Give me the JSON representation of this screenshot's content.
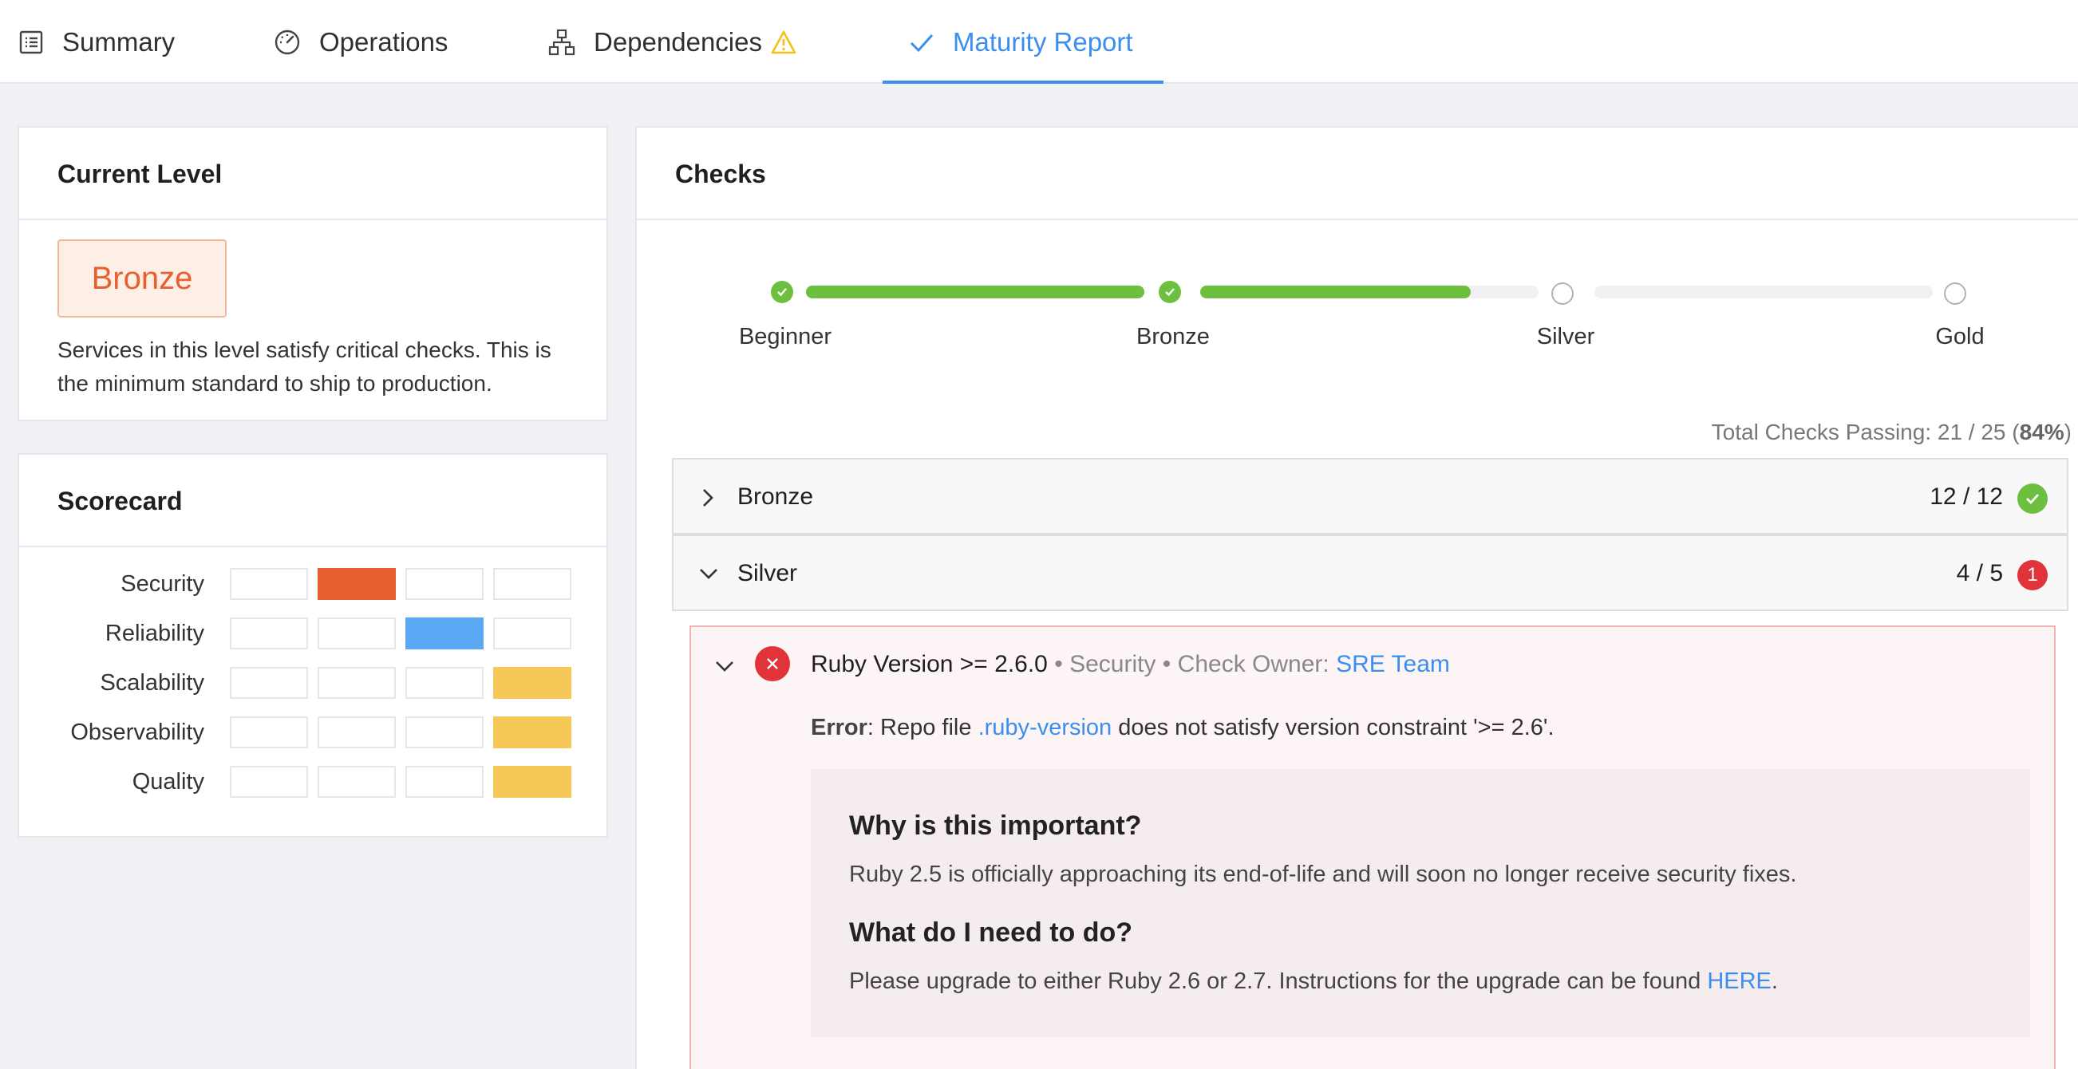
{
  "tabs": [
    {
      "label": "Summary",
      "icon": "list-icon"
    },
    {
      "label": "Operations",
      "icon": "gauge-icon"
    },
    {
      "label": "Dependencies",
      "icon": "hierarchy-icon",
      "warning_icon": "warning-icon"
    },
    {
      "label": "Maturity Report",
      "icon": "checkmark-icon",
      "active": true
    }
  ],
  "current_level": {
    "title": "Current Level",
    "level": "Bronze",
    "description": "Services in this level satisfy critical checks. This is the minimum standard to ship to production."
  },
  "scorecard": {
    "title": "Scorecard",
    "rows": [
      {
        "label": "Security",
        "level_index": 1,
        "color": "#e8602f"
      },
      {
        "label": "Reliability",
        "level_index": 2,
        "color": "#5ba8f5"
      },
      {
        "label": "Scalability",
        "level_index": 3,
        "color": "#f6c857"
      },
      {
        "label": "Observability",
        "level_index": 3,
        "color": "#f6c857"
      },
      {
        "label": "Quality",
        "level_index": 3,
        "color": "#f6c857"
      }
    ]
  },
  "checks": {
    "title": "Checks",
    "steps": [
      {
        "label": "Beginner",
        "done": true
      },
      {
        "label": "Bronze",
        "done": true
      },
      {
        "label": "Silver",
        "done": false
      },
      {
        "label": "Gold",
        "done": false
      }
    ],
    "progress_segments": [
      1.0,
      0.8,
      0.0
    ],
    "total_prefix": "Total Checks Passing: 21 / 25 (",
    "total_percent": "84%",
    "total_suffix": ")",
    "groups": [
      {
        "name": "Bronze",
        "count": "12 / 12",
        "status": "passed",
        "expanded": false
      },
      {
        "name": "Silver",
        "count": "4 / 5",
        "status": "failed",
        "failed_count": "1",
        "expanded": true
      }
    ],
    "failed_check": {
      "name": "Ruby Version >= 2.6.0",
      "separator": "•",
      "category": "Security",
      "owner_label": "Check Owner:",
      "owner": "SRE Team",
      "error_label": "Error",
      "error_pre": ": Repo file ",
      "error_file": ".ruby-version",
      "error_post": " does not satisfy version constraint '>= 2.6'.",
      "why_title": "Why is this important?",
      "why_text": "Ruby 2.5 is officially approaching its end-of-life and will soon no longer receive security fixes.",
      "todo_title": "What do I need to do?",
      "todo_text": "Please upgrade to either Ruby 2.6 or 2.7. Instructions for the upgrade can be found ",
      "todo_link": "HERE",
      "todo_end": "."
    }
  }
}
